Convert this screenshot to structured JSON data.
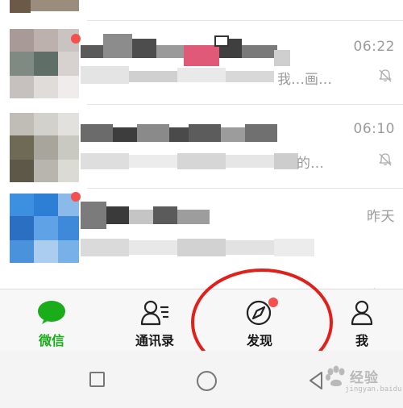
{
  "chats": [
    {
      "time": "06:22",
      "preview_end": "我…画…",
      "muted": true
    },
    {
      "time": "06:10",
      "preview_end": "的…",
      "muted": true
    },
    {
      "time": "昨天",
      "preview_end": "",
      "muted": false
    }
  ],
  "partial_bottom_time": "昨天",
  "tabbar": {
    "tabs": [
      {
        "label": "微信",
        "icon": "chat-bubble-icon",
        "active": true
      },
      {
        "label": "通讯录",
        "icon": "contacts-icon",
        "active": false
      },
      {
        "label": "发现",
        "icon": "compass-icon",
        "active": false,
        "has_badge": true
      },
      {
        "label": "我",
        "icon": "person-icon",
        "active": false
      }
    ]
  },
  "colors": {
    "active_green": "#1aad19",
    "badge_red": "#f5504e",
    "highlight_red": "#e0201b"
  },
  "navbar": {
    "buttons": [
      "recent-apps-icon",
      "home-icon",
      "back-icon"
    ]
  },
  "watermark": {
    "text": "经验",
    "sub": "jingyan.baidu.com"
  }
}
